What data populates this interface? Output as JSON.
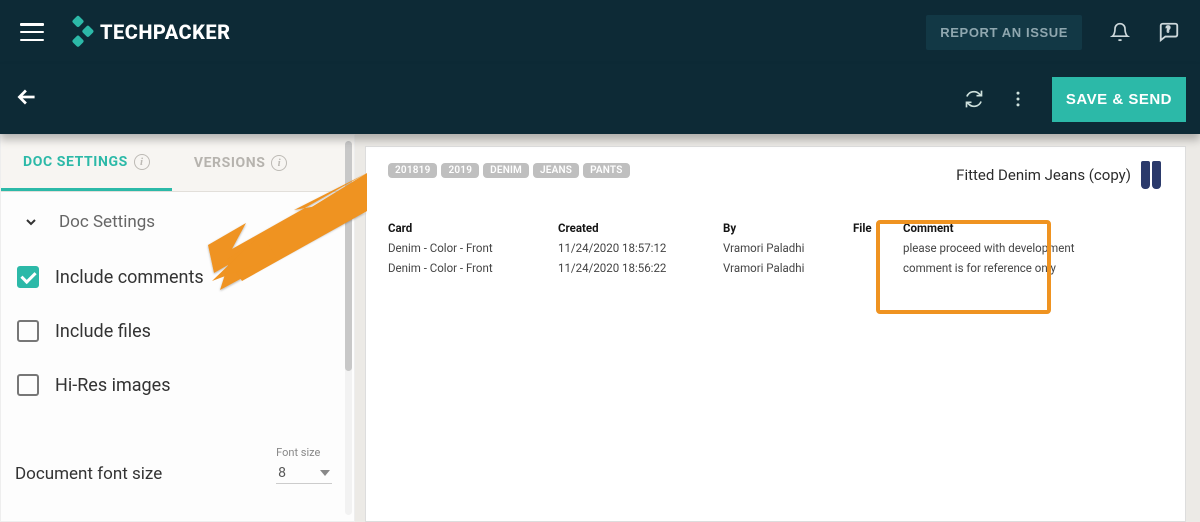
{
  "topbar": {
    "brand": "TECHPACKER",
    "report_label": "REPORT AN ISSUE"
  },
  "subbar": {
    "save_label": "SAVE & SEND"
  },
  "tabs": {
    "doc_settings": "DOC SETTINGS",
    "versions": "VERSIONS"
  },
  "panel": {
    "section_title": "Doc Settings",
    "include_comments": "Include comments",
    "include_files": "Include files",
    "hires_images": "Hi-Res images",
    "fontsize_label": "Document font size",
    "fontsize_caption": "Font size",
    "fontsize_value": "8"
  },
  "doc": {
    "title": "Fitted Denim Jeans (copy)",
    "chips": [
      "201819",
      "2019",
      "DENIM",
      "JEANS",
      "PANTS"
    ],
    "headers": {
      "card": "Card",
      "created": "Created",
      "by": "By",
      "file": "File",
      "comment": "Comment"
    },
    "rows": [
      {
        "card": "Denim - Color - Front",
        "created": "11/24/2020 18:57:12",
        "by": "Vramori Paladhi",
        "file": "",
        "comment": "please proceed with development"
      },
      {
        "card": "Denim - Color - Front",
        "created": "11/24/2020 18:56:22",
        "by": "Vramori Paladhi",
        "file": "",
        "comment": "comment is for reference only"
      }
    ]
  }
}
